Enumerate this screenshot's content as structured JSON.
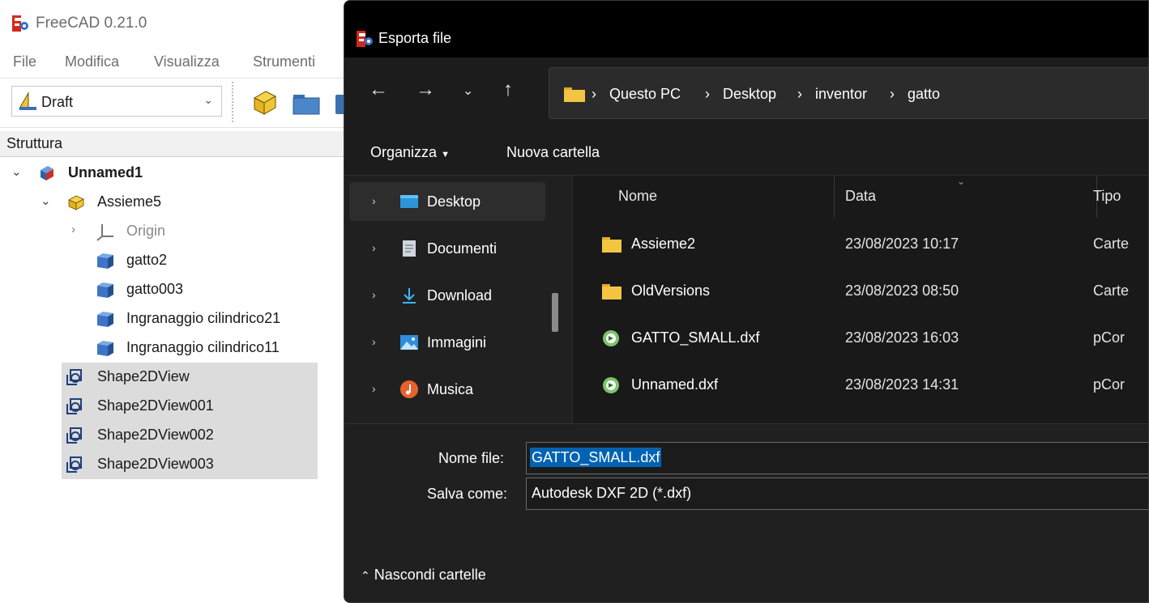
{
  "freecad": {
    "title": "FreeCAD 0.21.0",
    "menu": [
      "File",
      "Modifica",
      "Visualizza",
      "Strumenti"
    ],
    "workbench": "Draft",
    "structure_header": "Struttura",
    "tree": {
      "document": "Unnamed1",
      "assembly": "Assieme5",
      "origin": "Origin",
      "parts": [
        "gatto2",
        "gatto003",
        "Ingranaggio cilindrico21",
        "Ingranaggio cilindrico11"
      ],
      "views": [
        "Shape2DView",
        "Shape2DView001",
        "Shape2DView002",
        "Shape2DView003"
      ]
    }
  },
  "dialog": {
    "title": "Esporta file",
    "breadcrumb": [
      "Questo PC",
      "Desktop",
      "inventor",
      "gatto"
    ],
    "commands": {
      "organize": "Organizza",
      "new_folder": "Nuova cartella"
    },
    "nav_items": [
      "Desktop",
      "Documenti",
      "Download",
      "Immagini",
      "Musica"
    ],
    "columns": {
      "name": "Nome",
      "date": "Data",
      "type": "Tipo"
    },
    "files": [
      {
        "name": "Assieme2",
        "date": "23/08/2023 10:17",
        "type": "Carte",
        "kind": "folder"
      },
      {
        "name": "OldVersions",
        "date": "23/08/2023 08:50",
        "type": "Carte",
        "kind": "folder"
      },
      {
        "name": "GATTO_SMALL.dxf",
        "date": "23/08/2023 16:03",
        "type": "pCor",
        "kind": "dxf"
      },
      {
        "name": "Unnamed.dxf",
        "date": "23/08/2023 14:31",
        "type": "pCor",
        "kind": "dxf"
      }
    ],
    "filename_label": "Nome file:",
    "filename_value": "GATTO_SMALL.dxf",
    "saveas_label": "Salva come:",
    "saveas_value": "Autodesk DXF 2D (*.dxf)",
    "hide_folders": "Nascondi cartelle"
  },
  "colors": {
    "accent": "#0063b1",
    "folder": "#f4c542",
    "dialog_bg": "#202020",
    "selection_gray": "#dcdcdc"
  }
}
